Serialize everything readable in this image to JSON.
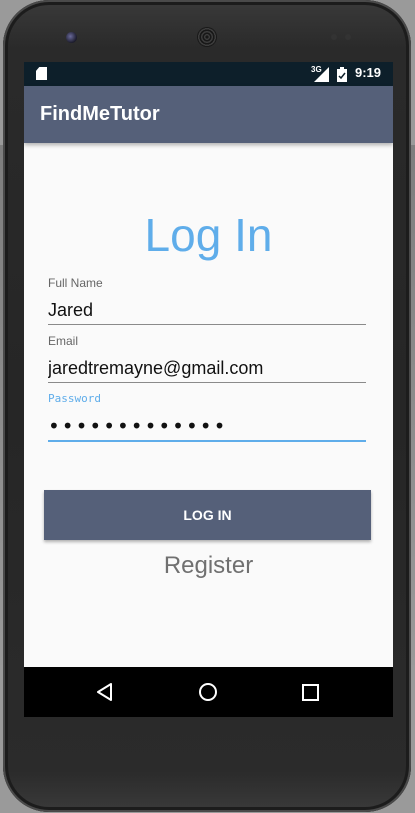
{
  "status_bar": {
    "network_type": "3G",
    "time": "9:19",
    "icons": [
      "sd-card-icon",
      "signal-icon",
      "battery-icon"
    ]
  },
  "app_bar": {
    "title": "FindMeTutor"
  },
  "login_form": {
    "heading": "Log In",
    "full_name": {
      "label": "Full Name",
      "value": "Jared"
    },
    "email": {
      "label": "Email",
      "value": "jaredtremayne@gmail.com"
    },
    "password": {
      "label": "Password",
      "value": "•••••••••••••"
    },
    "login_button_label": "LOG IN",
    "register_label": "Register"
  },
  "nav_bar": {
    "buttons": [
      "back-icon",
      "home-icon",
      "recents-icon"
    ]
  },
  "colors": {
    "primary": "#556079",
    "accent": "#5fadea",
    "status_bar": "#0d1f2a"
  }
}
